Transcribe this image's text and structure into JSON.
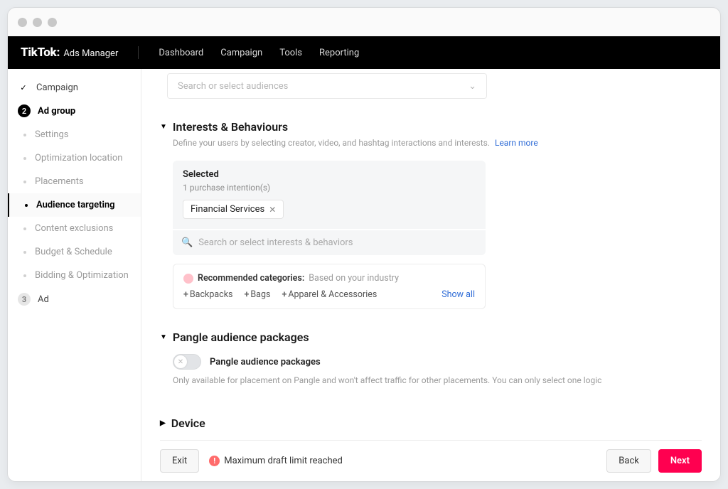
{
  "brand": {
    "name": "TikTok",
    "sep": ":",
    "sub": "Ads Manager"
  },
  "nav": {
    "dashboard": "Dashboard",
    "campaign": "Campaign",
    "tools": "Tools",
    "reporting": "Reporting"
  },
  "sidebar": {
    "steps": {
      "campaign": "Campaign",
      "adgroup": "Ad group",
      "adgroup_num": "2",
      "ad": "Ad",
      "ad_num": "3"
    },
    "subs": {
      "settings": "Settings",
      "optimization": "Optimization location",
      "placements": "Placements",
      "audience": "Audience targeting",
      "exclusions": "Content exclusions",
      "budget": "Budget & Schedule",
      "bidding": "Bidding & Optimization"
    }
  },
  "audiences_search": {
    "placeholder": "Search or select audiences"
  },
  "interests": {
    "title": "Interests & Behaviours",
    "subtitle": "Define your users by selecting creator, video, and hashtag interactions and interests.",
    "learn_more": "Learn more",
    "selected_label": "Selected",
    "selected_count": "1 purchase intention(s)",
    "chip": "Financial Services",
    "search_placeholder": "Search or select interests & behaviors",
    "reco_label": "Recommended categories:",
    "reco_basis": "Based on your industry",
    "reco_items": {
      "a": "Backpacks",
      "b": "Bags",
      "c": "Apparel & Accessories"
    },
    "show_all": "Show all"
  },
  "pangle": {
    "title": "Pangle audience packages",
    "toggle_label": "Pangle audience packages",
    "note": "Only available for placement on Pangle and won't affect traffic for other placements. You can only select one logic"
  },
  "device": {
    "title": "Device"
  },
  "footer": {
    "exit": "Exit",
    "warning": "Maximum draft limit reached",
    "back": "Back",
    "next": "Next"
  }
}
